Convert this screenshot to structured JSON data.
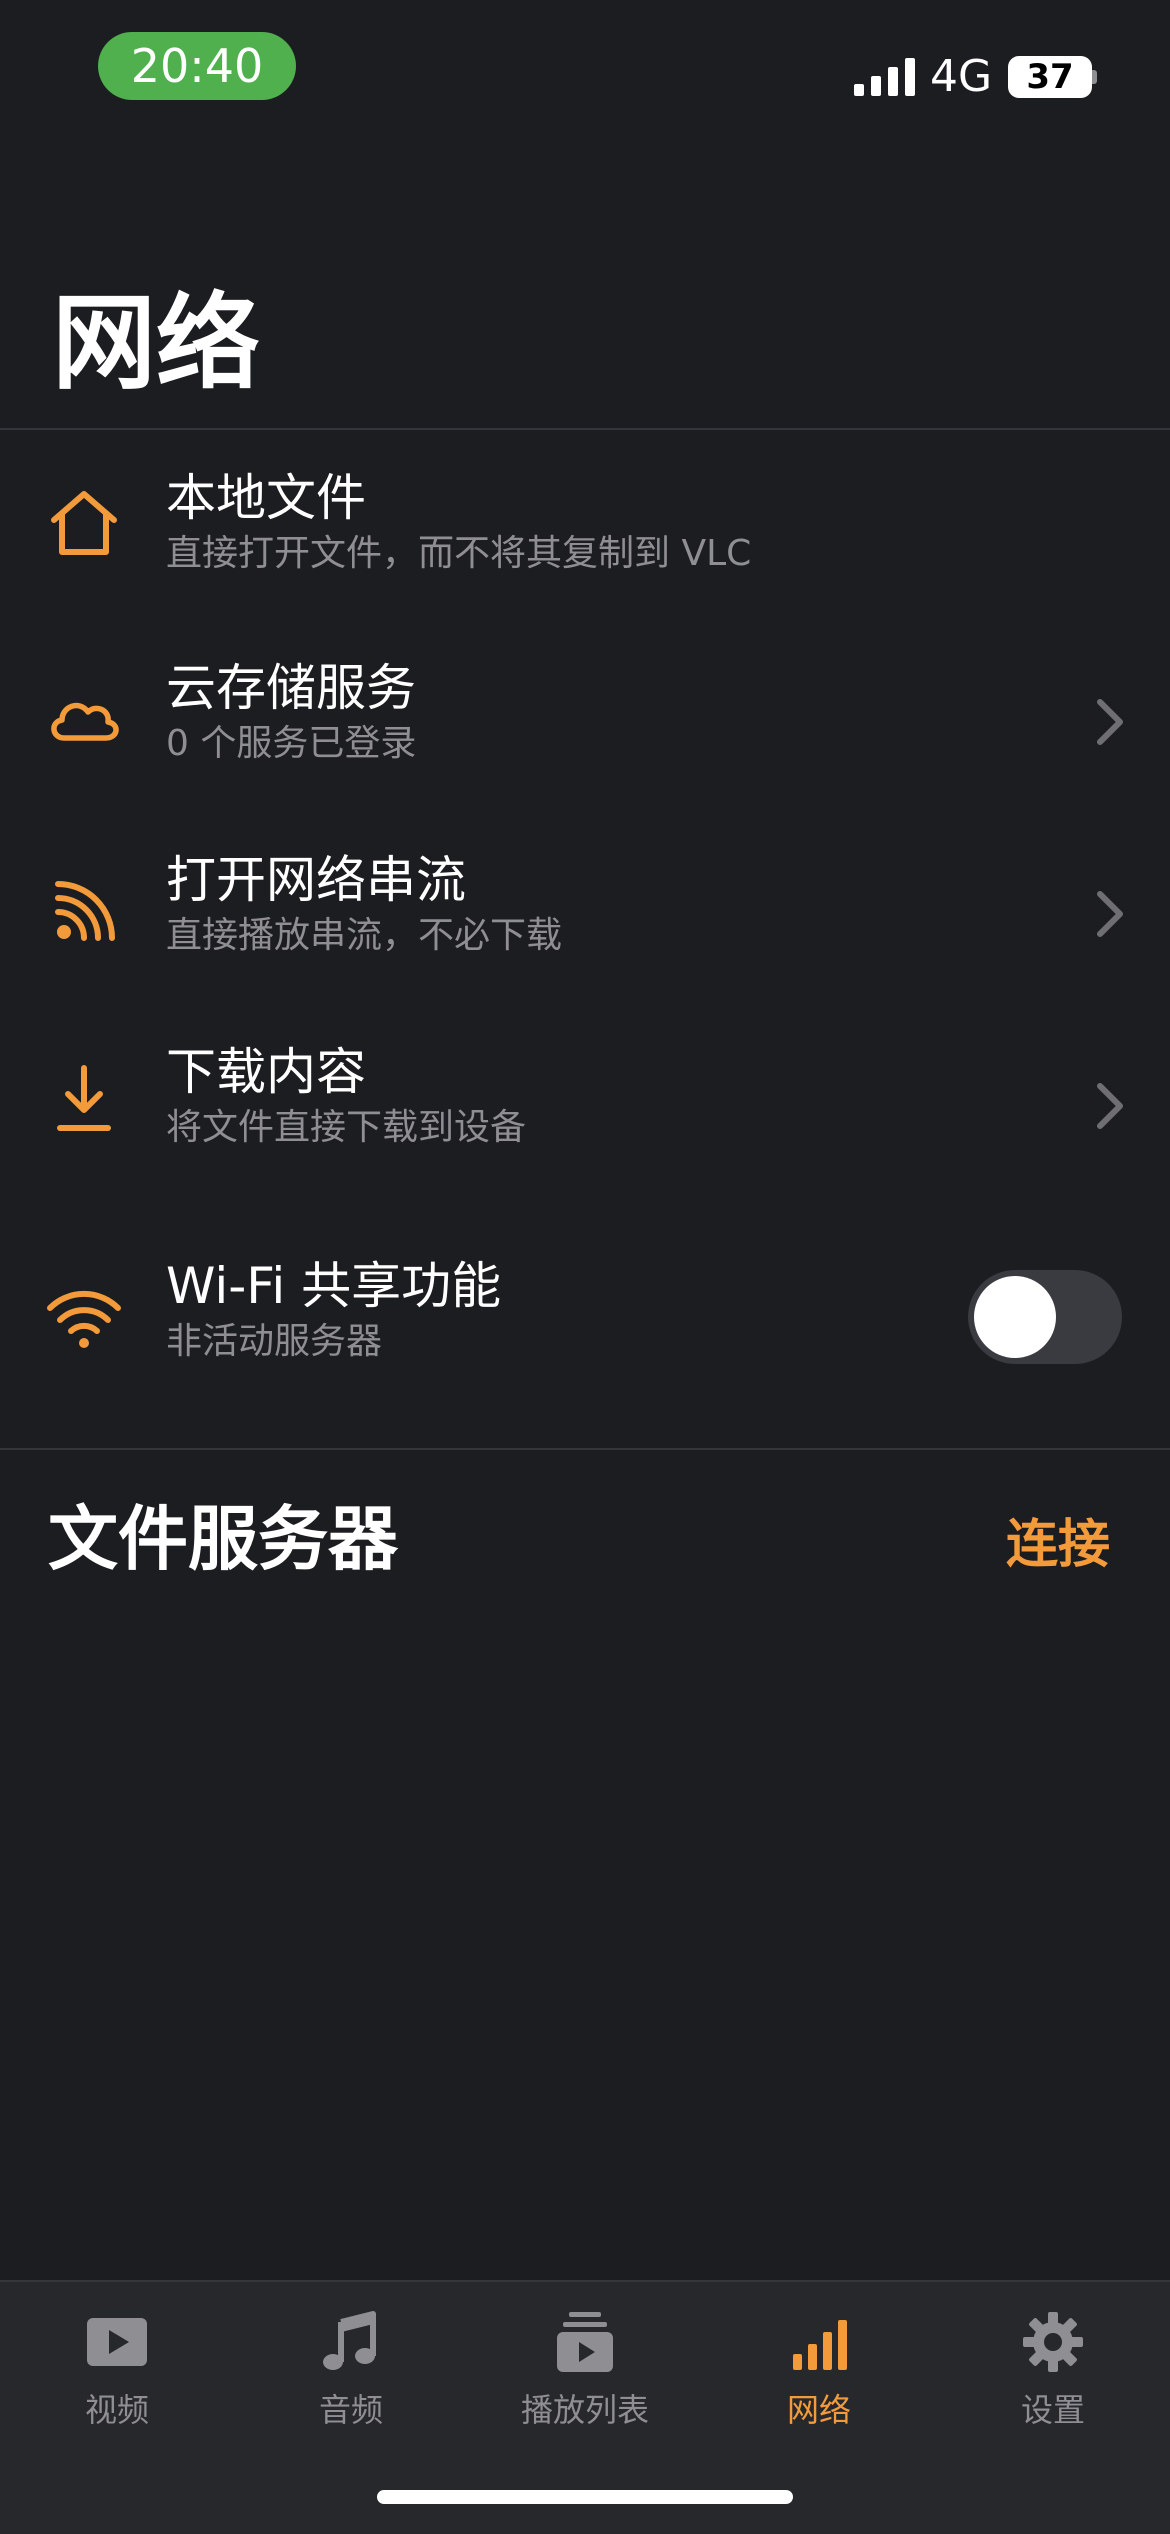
{
  "status_bar": {
    "time": "20:40",
    "network": "4G",
    "battery": "37"
  },
  "page": {
    "title": "网络"
  },
  "list": {
    "items": [
      {
        "title": "本地文件",
        "subtitle": "直接打开文件，而不将其复制到 VLC",
        "icon": "home-icon"
      },
      {
        "title": "云存储服务",
        "subtitle": "0 个服务已登录",
        "icon": "cloud-icon"
      },
      {
        "title": "打开网络串流",
        "subtitle": "直接播放串流，不必下载",
        "icon": "stream-icon"
      },
      {
        "title": "下载内容",
        "subtitle": "将文件直接下载到设备",
        "icon": "download-icon"
      },
      {
        "title": "Wi-Fi 共享功能",
        "subtitle": "非活动服务器",
        "icon": "wifi-icon",
        "toggle_on": false
      }
    ]
  },
  "file_servers": {
    "title": "文件服务器",
    "connect_label": "连接"
  },
  "tabs": [
    {
      "label": "视频",
      "icon": "video-icon",
      "active": false
    },
    {
      "label": "音频",
      "icon": "music-icon",
      "active": false
    },
    {
      "label": "播放列表",
      "icon": "playlist-icon",
      "active": false
    },
    {
      "label": "网络",
      "icon": "network-icon",
      "active": true
    },
    {
      "label": "设置",
      "icon": "gear-icon",
      "active": false
    }
  ],
  "colors": {
    "accent": "#f39a3b",
    "background": "#1c1d21",
    "tab_bar": "#27282c",
    "time_pill": "#4fb04d",
    "secondary_text": "#8e8e93"
  }
}
